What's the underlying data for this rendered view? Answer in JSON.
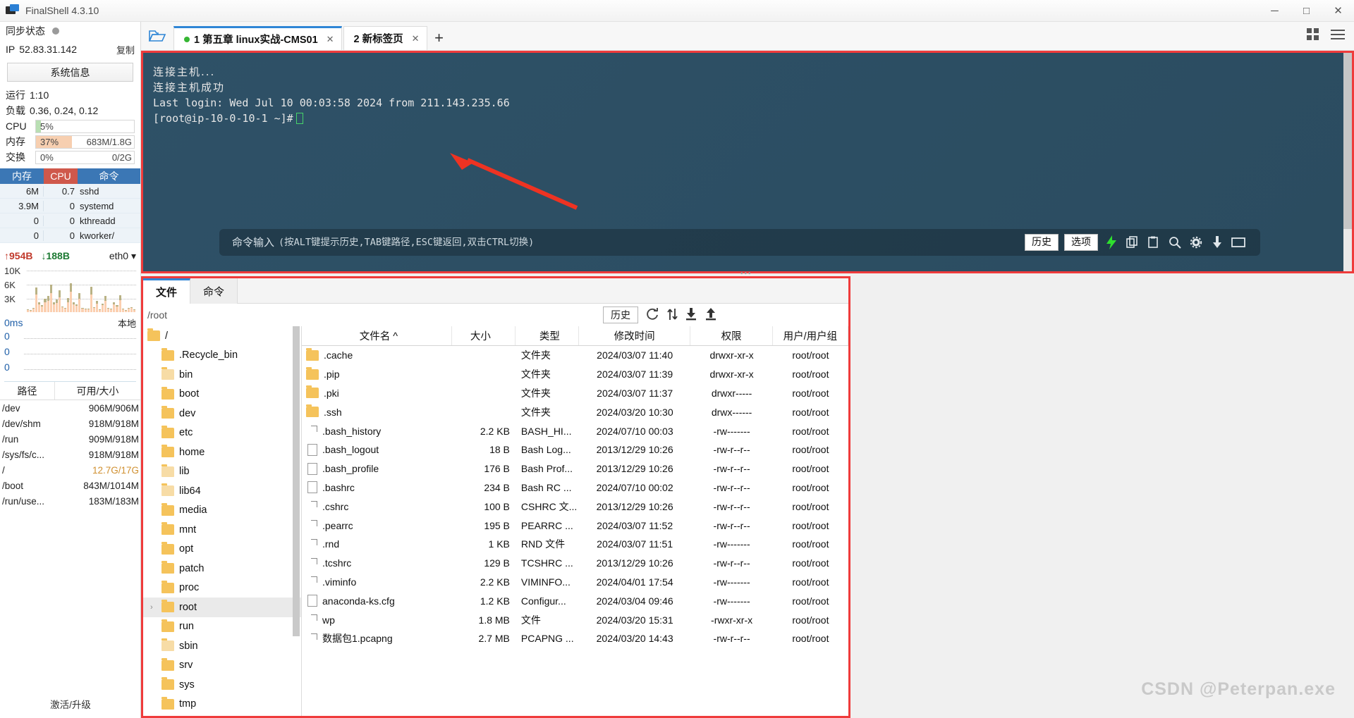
{
  "window": {
    "title": "FinalShell 4.3.10",
    "minimize": "─",
    "maximize": "□",
    "close": "✕"
  },
  "sidebar": {
    "sync_label": "同步状态",
    "ip_key": "IP",
    "ip_value": "52.83.31.142",
    "copy_label": "复制",
    "sysinfo_button": "系统信息",
    "uptime_key": "运行",
    "uptime_value": "1:10",
    "load_key": "负载",
    "load_value": "0.36, 0.24, 0.12",
    "meters": [
      {
        "name": "CPU",
        "pct": "5%",
        "right": "",
        "fill_pct": 5,
        "color": "#b9dfb3"
      },
      {
        "name": "内存",
        "pct": "37%",
        "right": "683M/1.8G",
        "fill_pct": 37,
        "color": "#f7cfb0"
      },
      {
        "name": "交换",
        "pct": "0%",
        "right": "0/2G",
        "fill_pct": 0,
        "color": "#f7cfb0"
      }
    ],
    "proc_headers": {
      "mem": "内存",
      "cpu": "CPU",
      "cmd": "命令"
    },
    "processes": [
      {
        "mem": "6M",
        "cpu": "0.7",
        "cmd": "sshd"
      },
      {
        "mem": "3.9M",
        "cpu": "0",
        "cmd": "systemd"
      },
      {
        "mem": "0",
        "cpu": "0",
        "cmd": "kthreadd"
      },
      {
        "mem": "0",
        "cpu": "0",
        "cmd": "kworker/"
      }
    ],
    "net": {
      "up": "↑954B",
      "down": "↓188B",
      "iface": "eth0 ▾",
      "y_labels": [
        "10K",
        "6K",
        "3K"
      ]
    },
    "latency": {
      "value": "0ms",
      "right_label": "本地",
      "rows": [
        "0",
        "0",
        "0"
      ]
    },
    "disk_headers": {
      "path": "路径",
      "avail": "可用/大小"
    },
    "disks": [
      {
        "path": "/dev",
        "avail": "906M/906M",
        "hl": false
      },
      {
        "path": "/dev/shm",
        "avail": "918M/918M",
        "hl": false
      },
      {
        "path": "/run",
        "avail": "909M/918M",
        "hl": false
      },
      {
        "path": "/sys/fs/c...",
        "avail": "918M/918M",
        "hl": false
      },
      {
        "path": "/",
        "avail": "12.7G/17G",
        "hl": true
      },
      {
        "path": "/boot",
        "avail": "843M/1014M",
        "hl": false
      },
      {
        "path": "/run/use...",
        "avail": "183M/183M",
        "hl": false
      }
    ],
    "activate_label": "激活/升级"
  },
  "tabbar": {
    "folder_icon": "folder-open-icon",
    "tabs": [
      {
        "label": "1 第五章 linux实战-CMS01",
        "active": true,
        "dot": true,
        "close": "✕"
      },
      {
        "label": "2 新标签页",
        "active": false,
        "dot": false,
        "close": "✕"
      }
    ],
    "add_tab": "+",
    "grid_icon": "grid-view-icon",
    "menu_icon": "hamburger-menu-icon"
  },
  "terminal": {
    "lines": [
      {
        "text": "连接主机...",
        "cjk": true
      },
      {
        "text": "连接主机成功",
        "cjk": true
      },
      {
        "text": "Last login: Wed Jul 10 00:03:58 2024 from 211.143.235.66",
        "cjk": false
      }
    ],
    "prompt": "[root@ip-10-0-10-1 ~]#",
    "command_placeholder_main": "命令输入",
    "command_placeholder_hint": "(按ALT键提示历史,TAB键路径,ESC键返回,双击CTRL切换)",
    "buttons": {
      "history": "历史",
      "options": "选项"
    },
    "icons": [
      "lightning-icon",
      "copy-icon",
      "paste-icon",
      "search-icon",
      "gear-icon",
      "download-icon",
      "window-icon"
    ]
  },
  "filepanel": {
    "tabs": [
      {
        "label": "文件",
        "active": true
      },
      {
        "label": "命令",
        "active": false
      }
    ],
    "path": "/root",
    "history_button": "历史",
    "tool_icons": [
      "refresh-icon",
      "sort-icon",
      "download-icon",
      "upload-icon"
    ],
    "tree": [
      {
        "label": "/",
        "level": 0,
        "type": "root",
        "selected": false
      },
      {
        "label": ".Recycle_bin",
        "level": 1,
        "type": "folder",
        "selected": false
      },
      {
        "label": "bin",
        "level": 1,
        "type": "link",
        "selected": false
      },
      {
        "label": "boot",
        "level": 1,
        "type": "folder",
        "selected": false
      },
      {
        "label": "dev",
        "level": 1,
        "type": "folder",
        "selected": false
      },
      {
        "label": "etc",
        "level": 1,
        "type": "folder",
        "selected": false
      },
      {
        "label": "home",
        "level": 1,
        "type": "folder",
        "selected": false
      },
      {
        "label": "lib",
        "level": 1,
        "type": "link",
        "selected": false
      },
      {
        "label": "lib64",
        "level": 1,
        "type": "link",
        "selected": false
      },
      {
        "label": "media",
        "level": 1,
        "type": "folder",
        "selected": false
      },
      {
        "label": "mnt",
        "level": 1,
        "type": "folder",
        "selected": false
      },
      {
        "label": "opt",
        "level": 1,
        "type": "folder",
        "selected": false
      },
      {
        "label": "patch",
        "level": 1,
        "type": "folder",
        "selected": false
      },
      {
        "label": "proc",
        "level": 1,
        "type": "folder",
        "selected": false
      },
      {
        "label": "root",
        "level": 1,
        "type": "folder",
        "selected": true
      },
      {
        "label": "run",
        "level": 1,
        "type": "folder",
        "selected": false
      },
      {
        "label": "sbin",
        "level": 1,
        "type": "link",
        "selected": false
      },
      {
        "label": "srv",
        "level": 1,
        "type": "folder",
        "selected": false
      },
      {
        "label": "sys",
        "level": 1,
        "type": "folder",
        "selected": false
      },
      {
        "label": "tmp",
        "level": 1,
        "type": "folder",
        "selected": false
      }
    ],
    "columns": [
      "文件名 ^",
      "大小",
      "类型",
      "修改时间",
      "权限",
      "用户/用户组"
    ],
    "files": [
      {
        "icon": "folder",
        "name": ".cache",
        "size": "",
        "type": "文件夹",
        "mtime": "2024/03/07 11:40",
        "perm": "drwxr-xr-x",
        "owner": "root/root"
      },
      {
        "icon": "folder",
        "name": ".pip",
        "size": "",
        "type": "文件夹",
        "mtime": "2024/03/07 11:39",
        "perm": "drwxr-xr-x",
        "owner": "root/root"
      },
      {
        "icon": "folder",
        "name": ".pki",
        "size": "",
        "type": "文件夹",
        "mtime": "2024/03/07 11:37",
        "perm": "drwxr-----",
        "owner": "root/root"
      },
      {
        "icon": "folder",
        "name": ".ssh",
        "size": "",
        "type": "文件夹",
        "mtime": "2024/03/20 10:30",
        "perm": "drwx------",
        "owner": "root/root"
      },
      {
        "icon": "gen",
        "name": ".bash_history",
        "size": "2.2 KB",
        "type": "BASH_HI...",
        "mtime": "2024/07/10 00:03",
        "perm": "-rw-------",
        "owner": "root/root"
      },
      {
        "icon": "doc",
        "name": ".bash_logout",
        "size": "18 B",
        "type": "Bash Log...",
        "mtime": "2013/12/29 10:26",
        "perm": "-rw-r--r--",
        "owner": "root/root"
      },
      {
        "icon": "doc",
        "name": ".bash_profile",
        "size": "176 B",
        "type": "Bash Prof...",
        "mtime": "2013/12/29 10:26",
        "perm": "-rw-r--r--",
        "owner": "root/root"
      },
      {
        "icon": "doc",
        "name": ".bashrc",
        "size": "234 B",
        "type": "Bash RC ...",
        "mtime": "2024/07/10 00:02",
        "perm": "-rw-r--r--",
        "owner": "root/root"
      },
      {
        "icon": "gen",
        "name": ".cshrc",
        "size": "100 B",
        "type": "CSHRC 文...",
        "mtime": "2013/12/29 10:26",
        "perm": "-rw-r--r--",
        "owner": "root/root"
      },
      {
        "icon": "gen",
        "name": ".pearrc",
        "size": "195 B",
        "type": "PEARRC ...",
        "mtime": "2024/03/07 11:52",
        "perm": "-rw-r--r--",
        "owner": "root/root"
      },
      {
        "icon": "gen",
        "name": ".rnd",
        "size": "1 KB",
        "type": "RND 文件",
        "mtime": "2024/03/07 11:51",
        "perm": "-rw-------",
        "owner": "root/root"
      },
      {
        "icon": "gen",
        "name": ".tcshrc",
        "size": "129 B",
        "type": "TCSHRC ...",
        "mtime": "2013/12/29 10:26",
        "perm": "-rw-r--r--",
        "owner": "root/root"
      },
      {
        "icon": "gen",
        "name": ".viminfo",
        "size": "2.2 KB",
        "type": "VIMINFO...",
        "mtime": "2024/04/01 17:54",
        "perm": "-rw-------",
        "owner": "root/root"
      },
      {
        "icon": "doc",
        "name": "anaconda-ks.cfg",
        "size": "1.2 KB",
        "type": "Configur...",
        "mtime": "2024/03/04 09:46",
        "perm": "-rw-------",
        "owner": "root/root"
      },
      {
        "icon": "gen",
        "name": "wp",
        "size": "1.8 MB",
        "type": "文件",
        "mtime": "2024/03/20 15:31",
        "perm": "-rwxr-xr-x",
        "owner": "root/root"
      },
      {
        "icon": "gen",
        "name": "数据包1.pcapng",
        "size": "2.7 MB",
        "type": "PCAPNG ...",
        "mtime": "2024/03/20 14:43",
        "perm": "-rw-r--r--",
        "owner": "root/root"
      }
    ]
  },
  "watermark": "CSDN @Peterpan.exe",
  "colors": {
    "accent": "#2f86d6",
    "highlight_border": "#ef3b3b",
    "terminal_bg": "#2d4f63",
    "header_blue": "#3b77b5",
    "header_red": "#cf584b"
  }
}
